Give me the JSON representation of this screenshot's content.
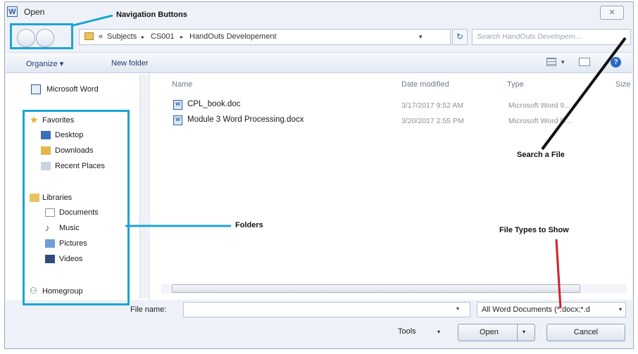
{
  "window": {
    "title": "Open",
    "app_icon": "W",
    "close_glyph": "✕"
  },
  "navigation": {
    "back_icon": "back-arrow-icon",
    "forward_icon": "forward-arrow-icon"
  },
  "address": {
    "prefix": "«",
    "crumbs": [
      "Subjects",
      "CS001",
      "HandOuts Developement"
    ],
    "separator": "▸",
    "dropdown_glyph": "▾",
    "refresh_glyph": "↻"
  },
  "search": {
    "placeholder": "Search HandOuts Developem..."
  },
  "toolbar": {
    "organize_label": "Organize ▾",
    "new_folder_label": "New folder",
    "views_arrow": "▾",
    "help_glyph": "?"
  },
  "sidebar": {
    "top": "Microsoft Word",
    "favorites_label": "Favorites",
    "favorites": [
      "Desktop",
      "Downloads",
      "Recent Places"
    ],
    "libraries_label": "Libraries",
    "libraries": [
      "Documents",
      "Music",
      "Pictures",
      "Videos"
    ],
    "homegroup_label": "Homegroup"
  },
  "columns": [
    "Name",
    "Date modified",
    "Type",
    "Size"
  ],
  "files": [
    {
      "name": "CPL_book.doc",
      "date": "3/17/2017 9:52 AM",
      "type": "Microsoft Word 9..."
    },
    {
      "name": "Module 3 Word Processing.docx",
      "date": "3/20/2017 2:55 PM",
      "type": "Microsoft Word D..."
    }
  ],
  "bottom": {
    "filename_label": "File name:",
    "filename_value": "",
    "dropdown_glyph": "▾",
    "filetype_value": "All Word Documents (*.docx;*.d",
    "tools_label": "Tools",
    "open_label": "Open",
    "cancel_label": "Cancel"
  },
  "annotations": {
    "navigation_buttons": "Navigation Buttons",
    "search_a_file": "Search a File",
    "folders": "Folders",
    "file_types": "File Types to Show"
  },
  "colors": {
    "annotation_box": "#1ca4d6",
    "arrow_black": "#111111",
    "arrow_red": "#d0202a",
    "accent": "#2c68c7"
  }
}
